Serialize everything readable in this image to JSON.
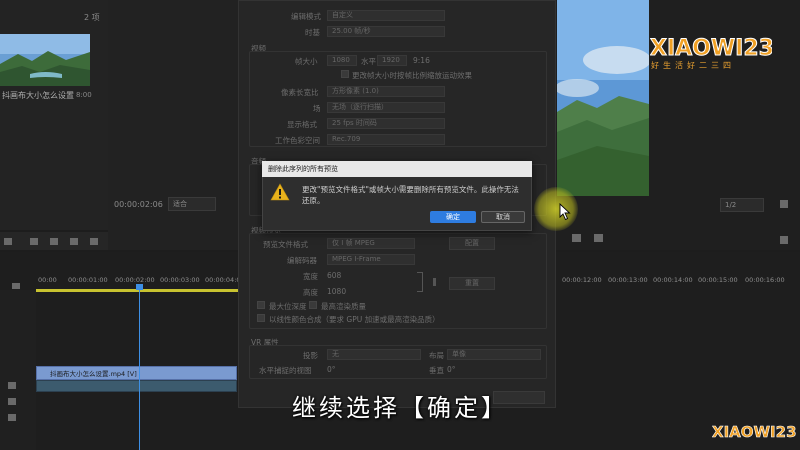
{
  "project": {
    "item_count": "2 项",
    "clip_name": "抖画布大小怎么设置",
    "clip_duration": "8:00"
  },
  "source": {
    "timecode": "00:00:02:06",
    "fit": "适合"
  },
  "program": {
    "fit": "1/2"
  },
  "timeline": {
    "ticks": [
      "00:00",
      "00:00:01:00",
      "00:00:02:00",
      "00:00:03:00",
      "00:00:04:00",
      "00:00:12:00",
      "00:00:13:00",
      "00:00:14:00",
      "00:00:15:00",
      "00:00:16:00"
    ],
    "video_clip_label": "抖画布大小怎么设置.mp4 [V]"
  },
  "settings": {
    "editing_mode_label": "编辑模式",
    "editing_mode_value": "自定义",
    "timebase_label": "时基",
    "timebase_value": "25.00 帧/秒",
    "video_group": "视频",
    "frame_size_label": "帧大小",
    "frame_w": "1080",
    "horizontal_label": "水平",
    "frame_h": "1920",
    "aspect_value": "9:16",
    "scale_checkbox": "更改帧大小时按帧比例缩放运动效果",
    "pixel_aspect_label": "像素长宽比",
    "pixel_aspect_value": "方形像素 (1.0)",
    "fields_label": "场",
    "fields_value": "无场（逐行扫描）",
    "display_format_label": "显示格式",
    "display_format_value": "25 fps 时间码",
    "color_space_label": "工作色彩空间",
    "color_space_value": "Rec.709",
    "audio_group": "音频",
    "preview_group": "视频预览",
    "preview_format_label": "预览文件格式",
    "preview_format_value": "仅 I 帧 MPEG",
    "codec_label": "编解码器",
    "codec_value": "MPEG I-Frame",
    "config_button": "配置",
    "width_label": "宽度",
    "width_value": "608",
    "height_label": "高度",
    "height_value": "1080",
    "reset_button": "重置",
    "max_depth_label": "最大位深度",
    "max_quality_label": "最高渲染质量",
    "linear_color_label": "以线性颜色合成（要求 GPU 加速或最高渲染品质）",
    "vr_group": "VR 属性",
    "projection_label": "投影",
    "projection_value": "无",
    "layout_label": "布局",
    "layout_value": "单像",
    "h_view_label": "水平捕捉的视图",
    "h_view_value": "0°",
    "vertical_label": "垂直",
    "vertical_value": "0°"
  },
  "alert": {
    "title": "删除此序列的所有预览",
    "message": "更改\"预览文件格式\"或帧大小需要删除所有预览文件。此操作无法还原。",
    "confirm": "确定",
    "cancel": "取消"
  },
  "caption": "继续选择【确定】",
  "watermark": {
    "brand": "XIAOWI234",
    "slogan": "好生活好二三四"
  },
  "colors": {
    "accent_blue": "#2e7ce0",
    "playhead": "#3d8fe5",
    "highlight": "#d2d228",
    "watermark_orange": "#e9a030"
  }
}
